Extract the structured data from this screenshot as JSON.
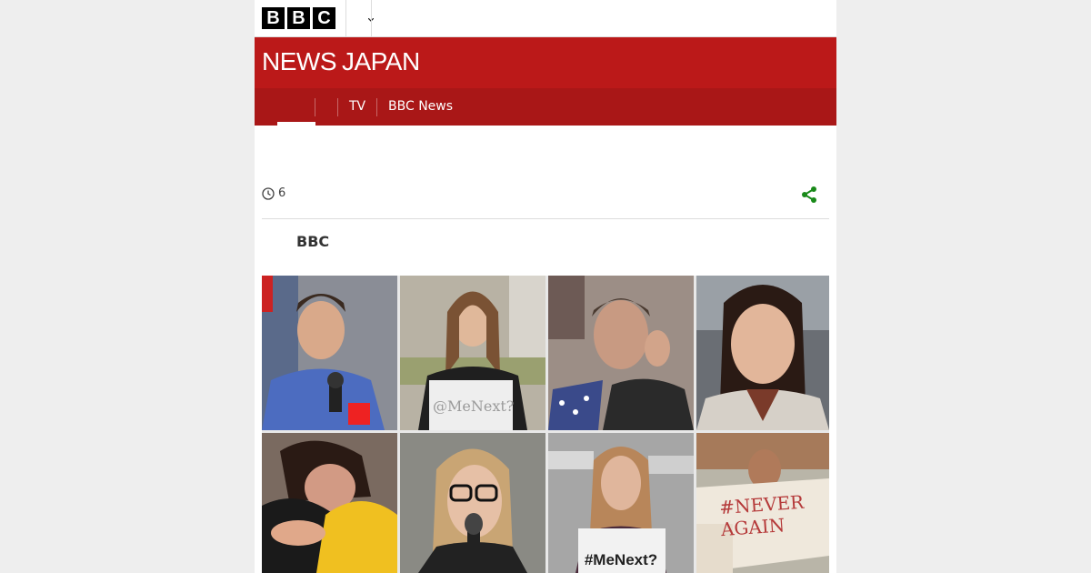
{
  "header": {
    "logo_letters": [
      "B",
      "B",
      "C"
    ],
    "more_icon": "chevron-down-icon"
  },
  "masthead": {
    "brand_news": "NEWS",
    "brand_region": "JAPAN"
  },
  "nav": {
    "items": [
      {
        "label": "TV"
      },
      {
        "label": "BBC News"
      }
    ]
  },
  "article": {
    "timestamp": "6",
    "timestamp_icon": "clock-icon",
    "share_icon": "share-icon",
    "byline": "BBC"
  },
  "photos": {
    "signs": [
      "@MeNext?",
      "#MeNext?",
      "#NEVER AGAIN"
    ]
  },
  "colors": {
    "masthead": "#bb1919",
    "nav": "#a91717",
    "share": "#1a8a1a"
  }
}
